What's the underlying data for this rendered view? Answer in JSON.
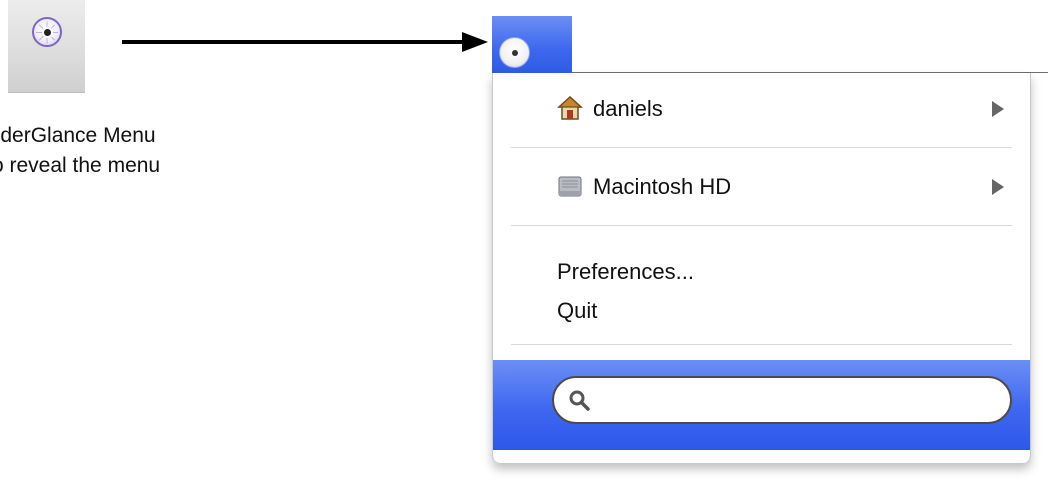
{
  "caption": {
    "line1": "olderGlance Menu",
    "line2": "o reveal the menu"
  },
  "menu": {
    "home_label": "daniels",
    "volume_label": "Macintosh HD",
    "preferences_label": "Preferences...",
    "quit_label": "Quit",
    "search_placeholder": ""
  },
  "colors": {
    "accent": "#3d67ee",
    "app_icon_ring": "#7d65c9"
  },
  "icons": {
    "app": "folderglance-icon",
    "home": "home-icon",
    "volume": "hard-drive-icon",
    "submenu": "chevron-right-icon",
    "search": "search-icon"
  }
}
